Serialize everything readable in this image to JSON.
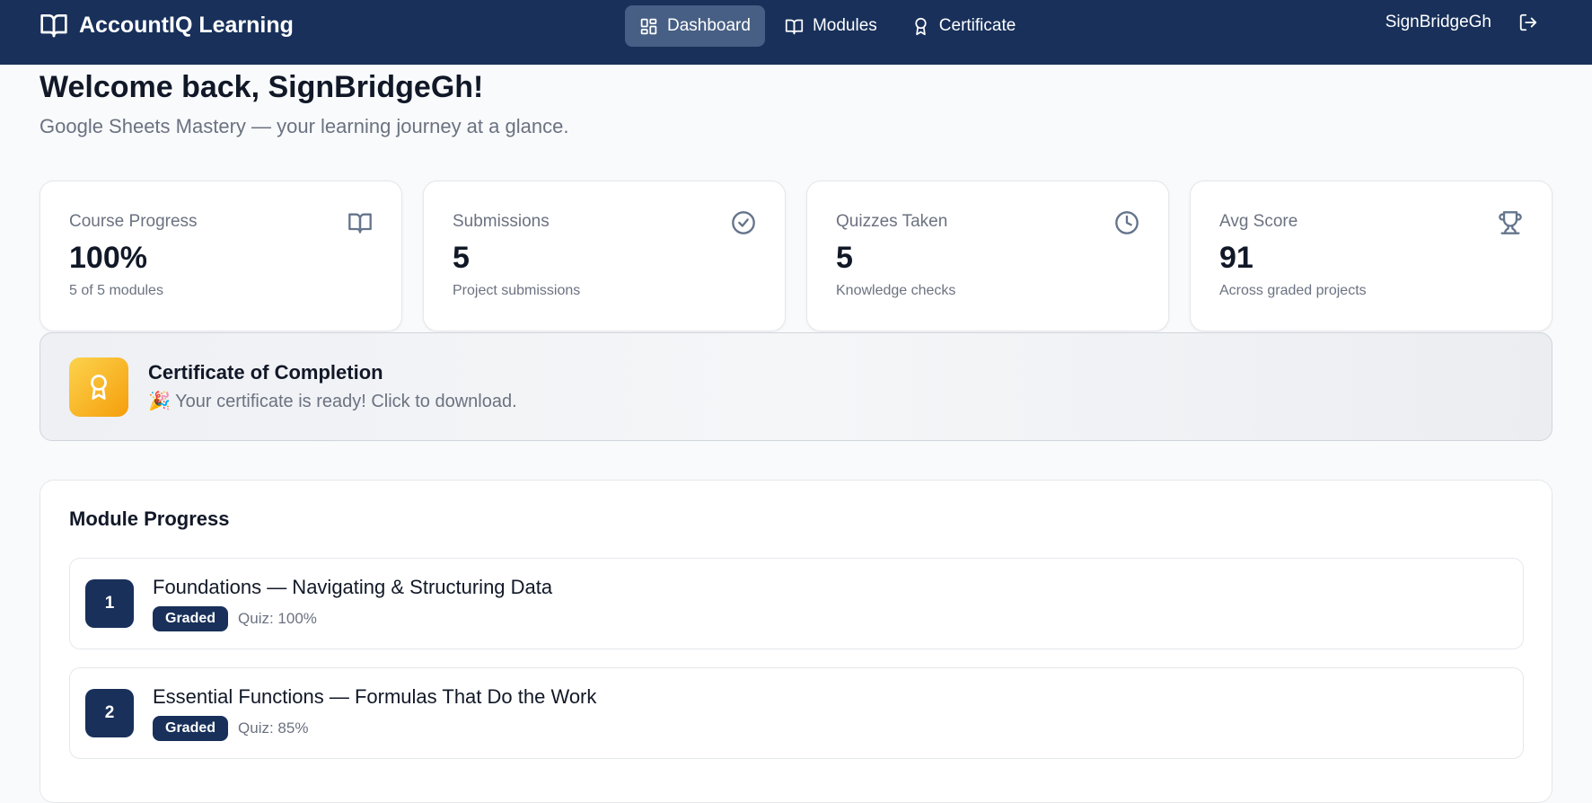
{
  "nav": {
    "brand": "AccountIQ Learning",
    "items": [
      {
        "label": "Dashboard",
        "icon": "dashboard-icon",
        "active": true
      },
      {
        "label": "Modules",
        "icon": "book-icon",
        "active": false
      },
      {
        "label": "Certificate",
        "icon": "award-icon",
        "active": false
      }
    ],
    "username": "SignBridgeGh"
  },
  "welcome": {
    "title": "Welcome back, SignBridgeGh!",
    "subtitle": "Google Sheets Mastery — your learning journey at a glance."
  },
  "stats": [
    {
      "label": "Course Progress",
      "value": "100%",
      "note": "5 of 5 modules",
      "icon": "book-open-icon"
    },
    {
      "label": "Submissions",
      "value": "5",
      "note": "Project submissions",
      "icon": "check-circle-icon"
    },
    {
      "label": "Quizzes Taken",
      "value": "5",
      "note": "Knowledge checks",
      "icon": "clock-icon"
    },
    {
      "label": "Avg Score",
      "value": "91",
      "note": "Across graded projects",
      "icon": "trophy-icon"
    }
  ],
  "certificate": {
    "title": "Certificate of Completion",
    "description": "🎉 Your certificate is ready! Click to download."
  },
  "modules": {
    "title": "Module Progress",
    "items": [
      {
        "number": "1",
        "title": "Foundations — Navigating & Structuring Data",
        "status": "Graded",
        "quiz": "Quiz: 100%"
      },
      {
        "number": "2",
        "title": "Essential Functions — Formulas That Do the Work",
        "status": "Graded",
        "quiz": "Quiz: 85%"
      }
    ]
  },
  "colors": {
    "navbar": "#18305a",
    "accent_gold": "#f59e0b",
    "background": "#f8fafc"
  }
}
